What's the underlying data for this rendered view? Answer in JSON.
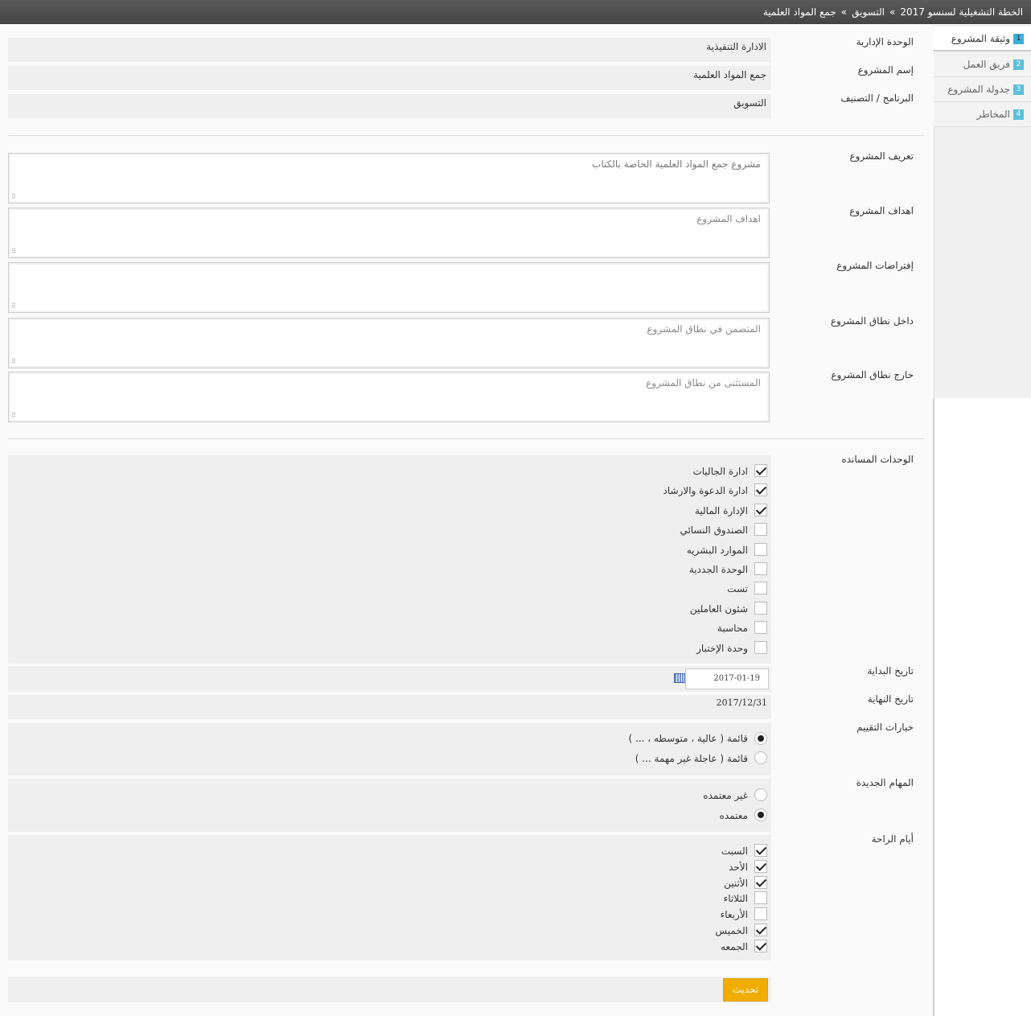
{
  "breadcrumb": {
    "items": [
      "الخطة التشغيلية لسنسو 2017",
      "التسويق",
      "جمع المواد العلمية"
    ],
    "separator": "»"
  },
  "sidebar": {
    "items": [
      {
        "num": "1",
        "label": "وثيقة المشروع",
        "active": true
      },
      {
        "num": "2",
        "label": "فريق العمل"
      },
      {
        "num": "3",
        "label": "جدولة المشروع"
      },
      {
        "num": "4",
        "label": "المخاطر"
      }
    ]
  },
  "info": {
    "admin_unit": {
      "label": "الوحدة الإدارية",
      "value": "الادارة التنفيذية"
    },
    "project_name": {
      "label": "إسم المشروع",
      "value": "جمع المواد العلمية"
    },
    "program": {
      "label": "البرنامج / التصنيف",
      "value": "التسويق"
    }
  },
  "textareas": {
    "definition": {
      "label": "تعريف المشروع",
      "value": "مشروع جمع المواد العلمية الخاصة بالكتاب",
      "placeholder": ""
    },
    "goals": {
      "label": "اهداف المشروع",
      "value": "",
      "placeholder": "اهداف المشروع"
    },
    "assumptions": {
      "label": "إفتراضات المشروع",
      "value": "",
      "placeholder": ""
    },
    "in_scope": {
      "label": "داخل نطاق المشروع",
      "value": "",
      "placeholder": "المتضمن في نطاق المشروع"
    },
    "out_scope": {
      "label": "خارج نطاق المشروع",
      "value": "",
      "placeholder": "المستثنى من نطاق المشروع"
    }
  },
  "support_units": {
    "label": "الوحدات المسانده",
    "options": [
      {
        "label": "ادارة الجاليات",
        "checked": true
      },
      {
        "label": "ادارة الدعوة والارشاد",
        "checked": true
      },
      {
        "label": "الإدارة المالية",
        "checked": true
      },
      {
        "label": "الصندوق النسائي",
        "checked": false
      },
      {
        "label": "الموارد البشريه",
        "checked": false
      },
      {
        "label": "الوحدة الجددية",
        "checked": false
      },
      {
        "label": "تست",
        "checked": false
      },
      {
        "label": "شئون العاملين",
        "checked": false
      },
      {
        "label": "محاسبة",
        "checked": false
      },
      {
        "label": "وحدة الإختبار",
        "checked": false
      }
    ]
  },
  "dates": {
    "start_label": "تاريخ البداية",
    "start_value": "2017-01-19",
    "end_label": "تاريخ النهاية",
    "end_value": "2017/12/31"
  },
  "evaluation": {
    "label": "خيارات التقييم",
    "options": [
      {
        "label": "قائمة ( عالية ، متوسطه ، ... )",
        "selected": true
      },
      {
        "label": "قائمة ( عاجلة غير مهمة ... )",
        "selected": false
      }
    ]
  },
  "new_tasks": {
    "label": "المهام الجديدة",
    "options": [
      {
        "label": "غير معتمده",
        "selected": false
      },
      {
        "label": "معتمده",
        "selected": true
      }
    ]
  },
  "rest_days": {
    "label": "أيام الراحة",
    "options": [
      {
        "label": "السبت",
        "checked": true
      },
      {
        "label": "الأحد",
        "checked": true
      },
      {
        "label": "الأثنين",
        "checked": true
      },
      {
        "label": "الثلاثاء",
        "checked": false
      },
      {
        "label": "الأربعاء",
        "checked": false
      },
      {
        "label": "الخميس",
        "checked": true
      },
      {
        "label": "الجمعه",
        "checked": true
      }
    ]
  },
  "actions": {
    "update_label": "تحديث"
  },
  "colors": {
    "accent": "#f0ad00",
    "badge": "#5bc0de",
    "topbar": "#4a4a4a"
  }
}
